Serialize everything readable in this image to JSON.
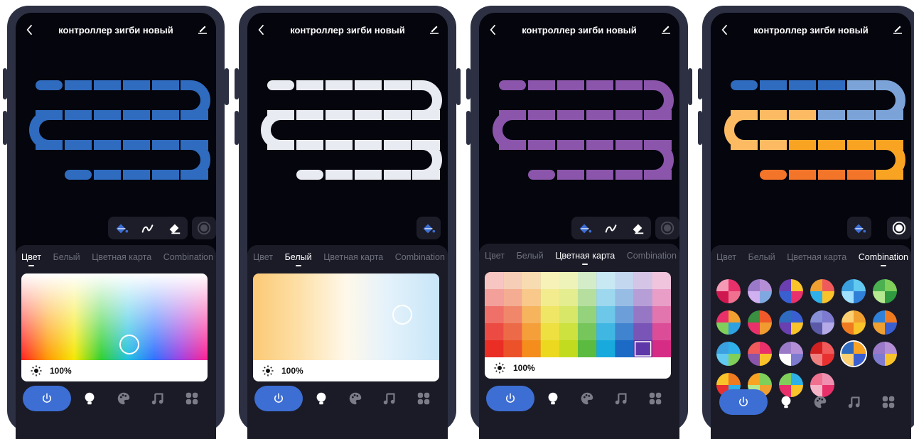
{
  "screens": [
    {
      "title": "контроллер зигби новый",
      "active_tab": 0,
      "brightness": "100%"
    },
    {
      "title": "контроллер зигби новый",
      "active_tab": 1,
      "brightness": "100%"
    },
    {
      "title": "контроллер зигби новый",
      "active_tab": 2,
      "brightness": "100%"
    },
    {
      "title": "контроллер зигби новый",
      "active_tab": 3
    }
  ],
  "tabs": [
    "Цвет",
    "Белый",
    "Цветная карта",
    "Combination"
  ],
  "colors": {
    "strip_blue": "#2f6bbf",
    "strip_white": "#e9ebf2",
    "strip_purple": "#8a55aa",
    "accent": "#3d6ed3",
    "frame": "#2c3042",
    "panel": "#1a1b27"
  },
  "icons": {
    "back": "back-arrow-icon",
    "edit": "edit-pencil-icon",
    "paint": "paint-bucket-icon",
    "brush": "brush-icon",
    "eraser": "eraser-icon",
    "record": "record-icon",
    "power": "power-icon",
    "bulb": "bulb-icon",
    "palette": "palette-icon",
    "music": "music-icon",
    "scenes": "grid-icon",
    "sun": "sun-icon"
  }
}
